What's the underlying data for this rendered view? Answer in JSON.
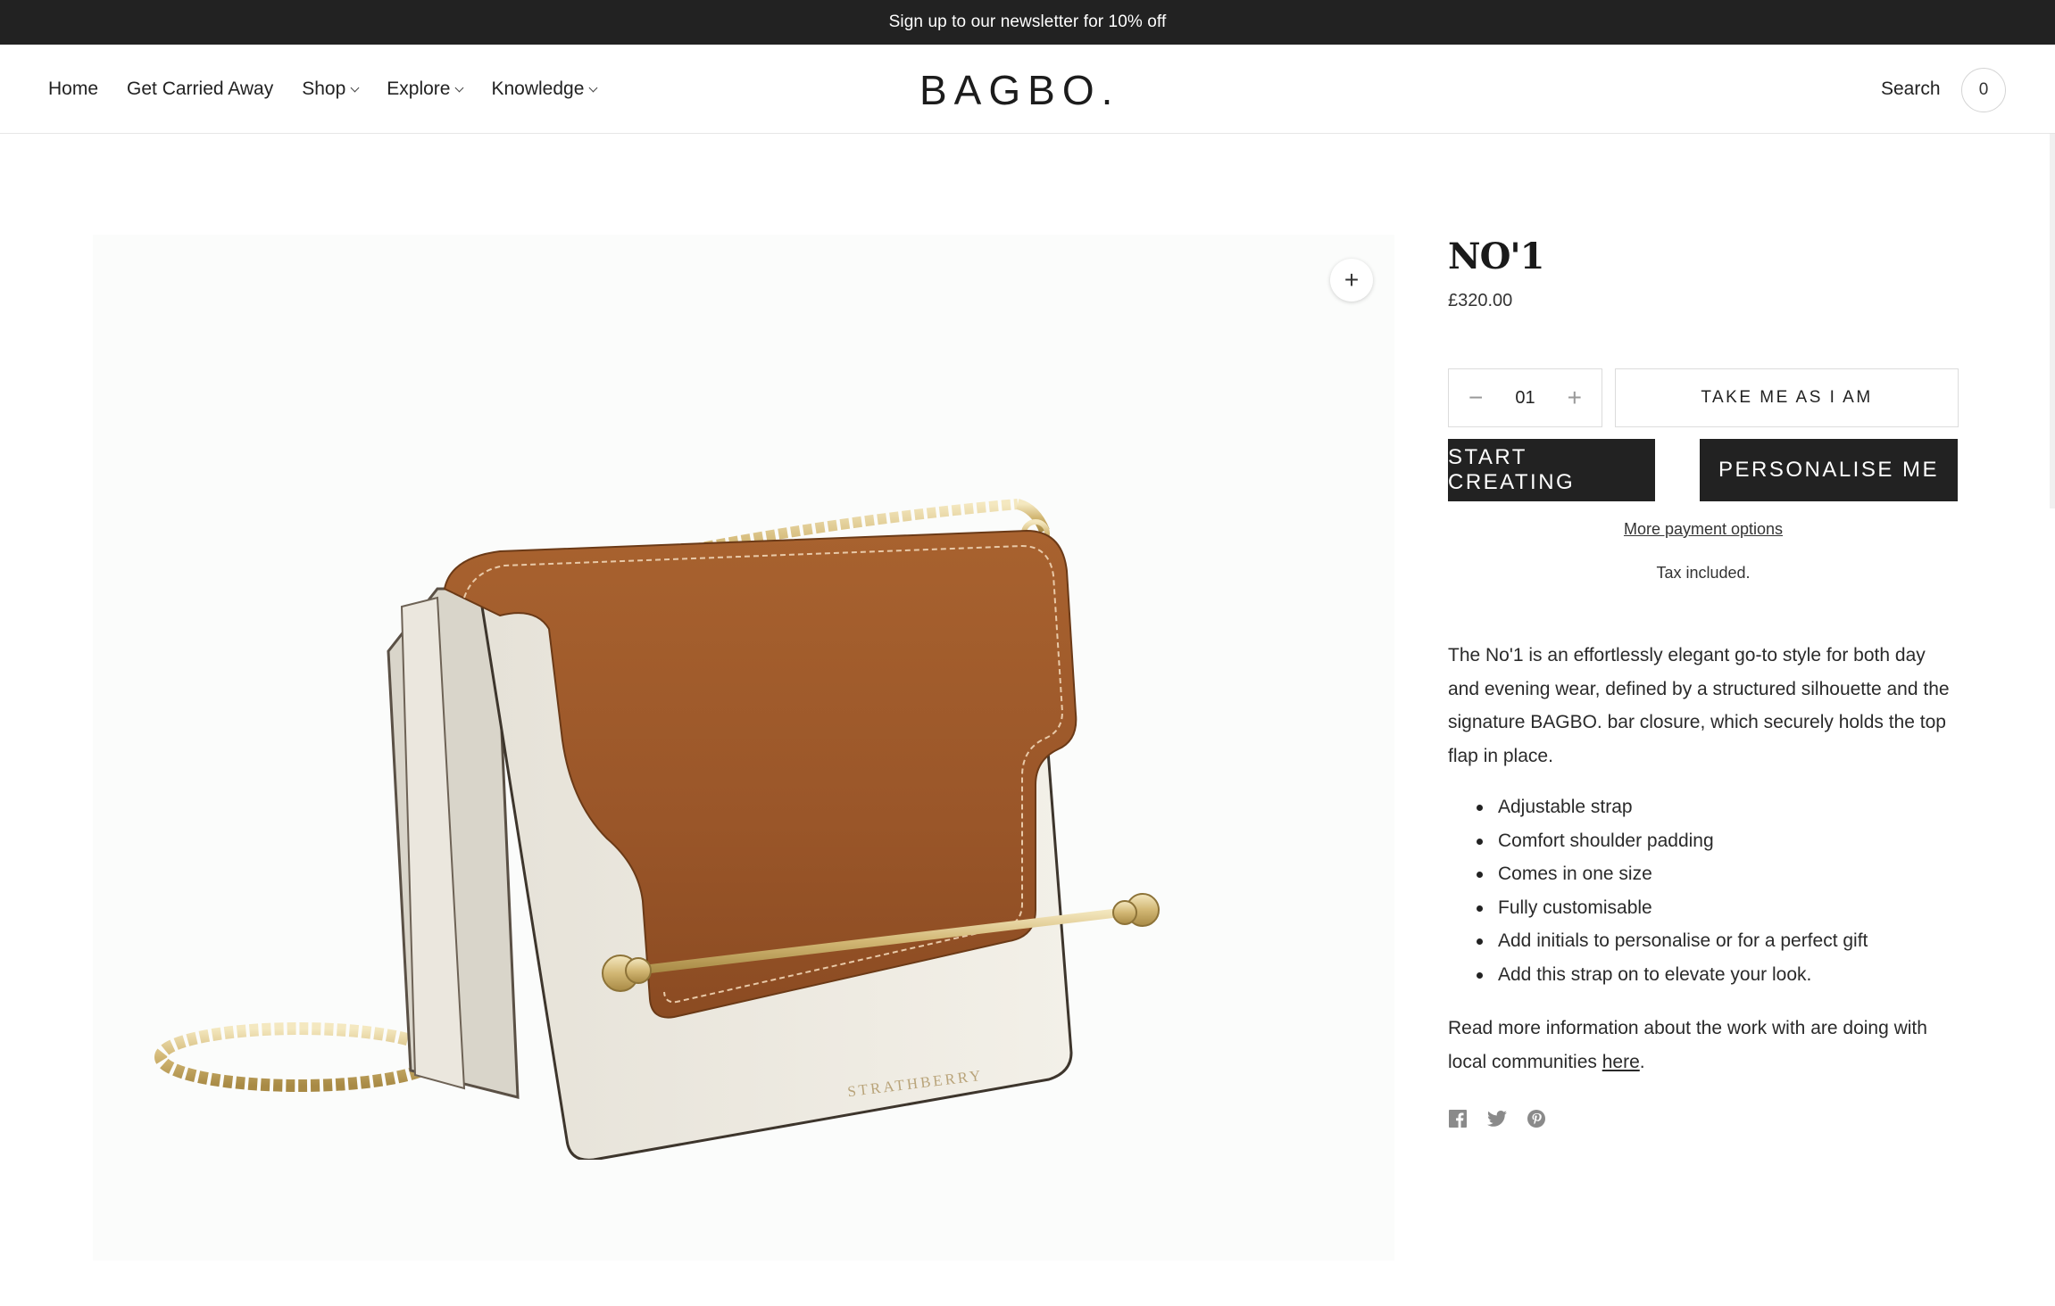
{
  "announcement": "Sign up to our newsletter for 10% off",
  "nav": {
    "home": "Home",
    "get_carried_away": "Get Carried Away",
    "shop": "Shop",
    "explore": "Explore",
    "knowledge": "Knowledge"
  },
  "logo": "BAGBO.",
  "header_right": {
    "search": "Search",
    "cart_count": "0"
  },
  "product": {
    "title": "NO'1",
    "price": "£320.00",
    "quantity": "01",
    "take_me_label": "TAKE ME AS I AM",
    "start_creating_label": "START CREATING",
    "personalise_label": "PERSONALISE ME",
    "more_payment": "More payment options",
    "tax_note": "Tax included.",
    "description": "The No'1 is an effortlessly elegant go-to style for both day and evening wear, defined by a structured silhouette and the signature BAGBO. bar closure, which securely holds the top flap in place.",
    "features": [
      "Adjustable strap",
      "Comfort shoulder padding",
      "Comes in one size",
      "Fully customisable",
      "Add initials to personalise or for a perfect gift",
      "Add this strap on to elevate your look."
    ],
    "more_info_text": "Read more information about the work with are doing with local communities ",
    "more_info_link": "here",
    "more_info_end": ".",
    "bag_stamp": "STRATHBERRY"
  },
  "icons": {
    "zoom": "plus-icon",
    "social": [
      "facebook-icon",
      "twitter-icon",
      "pinterest-icon"
    ]
  },
  "colors": {
    "announcement_bg": "#222222",
    "button_dark": "#222222",
    "leather_tan": "#9c5a2e",
    "leather_cream": "#ede9e0",
    "hardware_gold": "#d9c48e"
  }
}
